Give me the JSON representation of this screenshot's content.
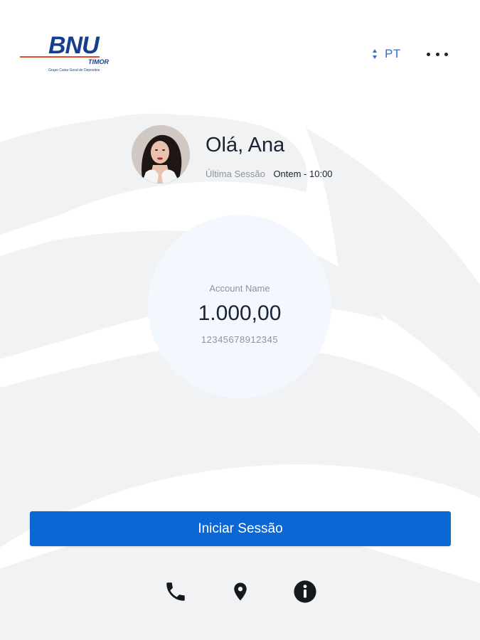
{
  "header": {
    "logo": {
      "wordmark": "BNU",
      "subtitle": "TIMOR",
      "group_text": "Grupo Caixa Geral de Depositos"
    },
    "language": {
      "code": "PT",
      "icon": "sort-arrows-icon"
    },
    "more_menu_icon": "more-horizontal-icon"
  },
  "profile": {
    "greeting": "Olá, Ana",
    "last_session_label": "Última Sessão",
    "last_session_value": "Ontem - 10:00"
  },
  "account": {
    "name": "Account Name",
    "balance": "1.000,00",
    "number": "12345678912345"
  },
  "actions": {
    "login_label": "Iniciar Sessão"
  },
  "footer": {
    "icons": [
      "phone-icon",
      "location-pin-icon",
      "info-icon"
    ]
  },
  "colors": {
    "primary": "#0b67d3",
    "brand_blue": "#163e8e",
    "brand_red": "#e0492a",
    "text_dark": "#1b2233",
    "text_muted": "#8e939c",
    "circle_bg": "#f3f7fe",
    "background_art": "#f1f2f4"
  }
}
